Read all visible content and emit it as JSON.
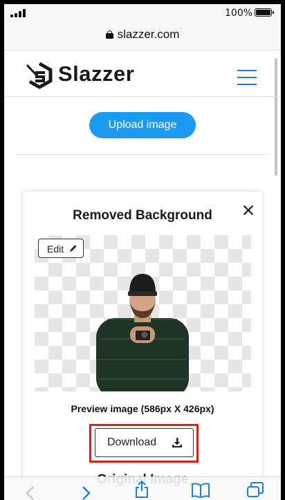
{
  "status_bar": {
    "battery_percent": "100%",
    "signal_bars": 4
  },
  "browser": {
    "url": "slazzer.com"
  },
  "site_header": {
    "logo_text": "Slazzer",
    "accent_color": "#1e7fe0"
  },
  "main": {
    "upload_button_label": "Upload image",
    "upload_button_color": "#1d9bf0"
  },
  "result_card": {
    "title": "Removed Background",
    "edit_label": "Edit",
    "preview_caption": "Preview image (586px X 426px)",
    "download_label": "Download",
    "highlight_color": "#e21b1b",
    "next_section_title": "Original Image"
  },
  "toolbar": {
    "icons": [
      "back-icon",
      "forward-icon",
      "share-icon",
      "bookmarks-icon",
      "tabs-icon"
    ]
  }
}
